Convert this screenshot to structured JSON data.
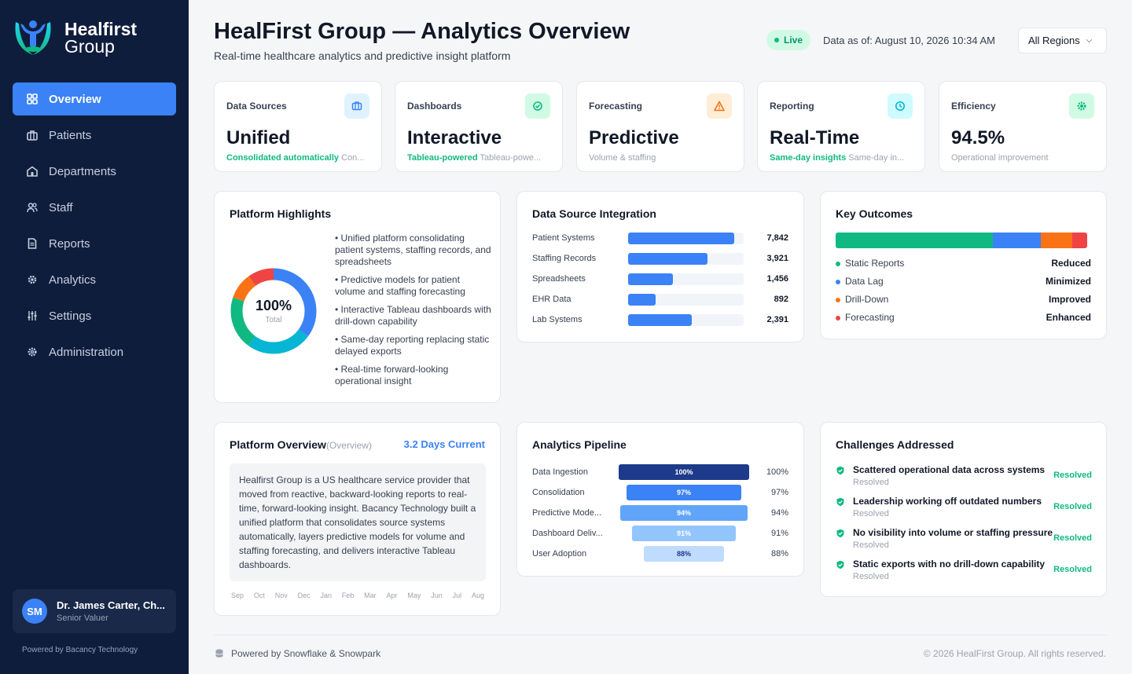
{
  "brand": {
    "name_line1": "Healfirst",
    "name_line2": "Group"
  },
  "sidebar": {
    "items": [
      {
        "label": "Overview",
        "icon": "grid-icon",
        "active": true
      },
      {
        "label": "Patients",
        "icon": "briefcase-medical-icon"
      },
      {
        "label": "Departments",
        "icon": "building-icon"
      },
      {
        "label": "Staff",
        "icon": "users-icon"
      },
      {
        "label": "Reports",
        "icon": "document-icon"
      },
      {
        "label": "Analytics",
        "icon": "analytics-cog-icon"
      },
      {
        "label": "Settings",
        "icon": "sliders-icon"
      },
      {
        "label": "Administration",
        "icon": "gear-icon"
      }
    ],
    "user": {
      "initials": "SM",
      "name": "Dr. James Carter, Ch...",
      "role": "Senior Valuer"
    },
    "powered": "Powered by Bacancy Technology"
  },
  "header": {
    "title": "HealFirst Group — Analytics Overview",
    "subtitle": "Real-time healthcare analytics and predictive insight platform",
    "live": "Live",
    "data_as_of": "Data as of: August 10, 2026 10:34 AM",
    "region": "All Regions"
  },
  "kpis": [
    {
      "label": "Data Sources",
      "value": "Unified",
      "highlight": "Consolidated automatically",
      "sub": "Con...",
      "icon": "server-icon",
      "icon_bg": "#e0f2fe",
      "icon_color": "#3b82f6"
    },
    {
      "label": "Dashboards",
      "value": "Interactive",
      "highlight": "Tableau-powered",
      "sub": "Tableau-powe...",
      "icon": "check-circle-icon",
      "icon_bg": "#d1fae5",
      "icon_color": "#10b981"
    },
    {
      "label": "Forecasting",
      "value": "Predictive",
      "highlight": "",
      "sub": "Volume & staffing",
      "icon": "warning-icon",
      "icon_bg": "#ffedd5",
      "icon_color": "#f97316"
    },
    {
      "label": "Reporting",
      "value": "Real-Time",
      "highlight": "Same-day insights",
      "sub": "Same-day in...",
      "icon": "clock-icon",
      "icon_bg": "#cffafe",
      "icon_color": "#06b6d4"
    },
    {
      "label": "Efficiency",
      "value": "94.5%",
      "highlight": "",
      "sub": "Operational improvement",
      "icon": "gear-badge-icon",
      "icon_bg": "#d1fae5",
      "icon_color": "#10b981"
    }
  ],
  "highlights": {
    "title": "Platform Highlights",
    "donut_value": "100%",
    "donut_label": "Total",
    "donut_segments": [
      {
        "value": 35,
        "color": "#3b82f6"
      },
      {
        "value": 25,
        "color": "#06b6d4"
      },
      {
        "value": 20,
        "color": "#10b981"
      },
      {
        "value": 10,
        "color": "#f97316"
      },
      {
        "value": 10,
        "color": "#ef4444"
      }
    ],
    "items": [
      "• Unified platform consolidating patient systems, staffing records, and spreadsheets",
      "• Predictive models for patient volume and staffing forecasting",
      "• Interactive Tableau dashboards with drill-down capability",
      "• Same-day reporting replacing static delayed exports",
      "• Real-time forward-looking operational insight"
    ]
  },
  "integration": {
    "title": "Data Source Integration",
    "rows": [
      {
        "label": "Patient Systems",
        "value": "7,842",
        "fill": 0.92
      },
      {
        "label": "Staffing Records",
        "value": "3,921",
        "fill": 0.69
      },
      {
        "label": "Spreadsheets",
        "value": "1,456",
        "fill": 0.39
      },
      {
        "label": "EHR Data",
        "value": "892",
        "fill": 0.24
      },
      {
        "label": "Lab Systems",
        "value": "2,391",
        "fill": 0.55
      }
    ]
  },
  "outcomes": {
    "title": "Key Outcomes",
    "segments": [
      {
        "share": 0.625,
        "color": "#10b981"
      },
      {
        "share": 0.19,
        "color": "#3b82f6"
      },
      {
        "share": 0.125,
        "color": "#f97316"
      },
      {
        "share": 0.06,
        "color": "#ef4444"
      }
    ],
    "rows": [
      {
        "label": "Static Reports",
        "value": "Reduced",
        "color": "#10b981"
      },
      {
        "label": "Data Lag",
        "value": "Minimized",
        "color": "#3b82f6"
      },
      {
        "label": "Drill-Down",
        "value": "Improved",
        "color": "#f97316"
      },
      {
        "label": "Forecasting",
        "value": "Enhanced",
        "color": "#ef4444"
      }
    ]
  },
  "overview": {
    "title": "Platform Overview",
    "paren": "(Overview)",
    "link": "3.2 Days Current",
    "text": "Healfirst Group is a US healthcare service provider that moved from reactive, backward-looking reports to real-time, forward-looking insight. Bacancy Technology built a unified platform that consolidates source systems automatically, layers predictive models for volume and staffing forecasting, and delivers interactive Tableau dashboards.",
    "months": [
      "Sep",
      "Oct",
      "Nov",
      "Dec",
      "Jan",
      "Feb",
      "Mar",
      "Apr",
      "May",
      "Jun",
      "Jul",
      "Aug"
    ]
  },
  "pipeline": {
    "title": "Analytics Pipeline",
    "rows": [
      {
        "label": "Data Ingestion",
        "bar": "100%",
        "value": "100%",
        "pct": 100,
        "color": "#1e3a8a",
        "text_color": "#ffffff"
      },
      {
        "label": "Consolidation",
        "bar": "97%",
        "value": "97%",
        "pct": 88,
        "color": "#3b82f6",
        "text_color": "#ffffff"
      },
      {
        "label": "Predictive Mode...",
        "bar": "94%",
        "value": "94%",
        "pct": 97,
        "color": "#60a5fa",
        "text_color": "#ffffff"
      },
      {
        "label": "Dashboard Deliv...",
        "bar": "91%",
        "value": "91%",
        "pct": 79,
        "color": "#93c5fd",
        "text_color": "#ffffff"
      },
      {
        "label": "User Adoption",
        "bar": "88%",
        "value": "88%",
        "pct": 61,
        "color": "#bfdbfe",
        "text_color": "#1e3a8a"
      }
    ]
  },
  "challenges": {
    "title": "Challenges Addressed",
    "rows": [
      {
        "title": "Scattered operational data across systems",
        "sub": "Resolved",
        "status": "Resolved"
      },
      {
        "title": "Leadership working off outdated numbers",
        "sub": "Resolved",
        "status": "Resolved"
      },
      {
        "title": "No visibility into volume or staffing pressure",
        "sub": "Resolved",
        "status": "Resolved"
      },
      {
        "title": "Static exports with no drill-down capability",
        "sub": "Resolved",
        "status": "Resolved"
      }
    ]
  },
  "footer": {
    "left": "Powered by Snowflake & Snowpark",
    "right": "© 2026 HealFirst Group. All rights reserved."
  }
}
